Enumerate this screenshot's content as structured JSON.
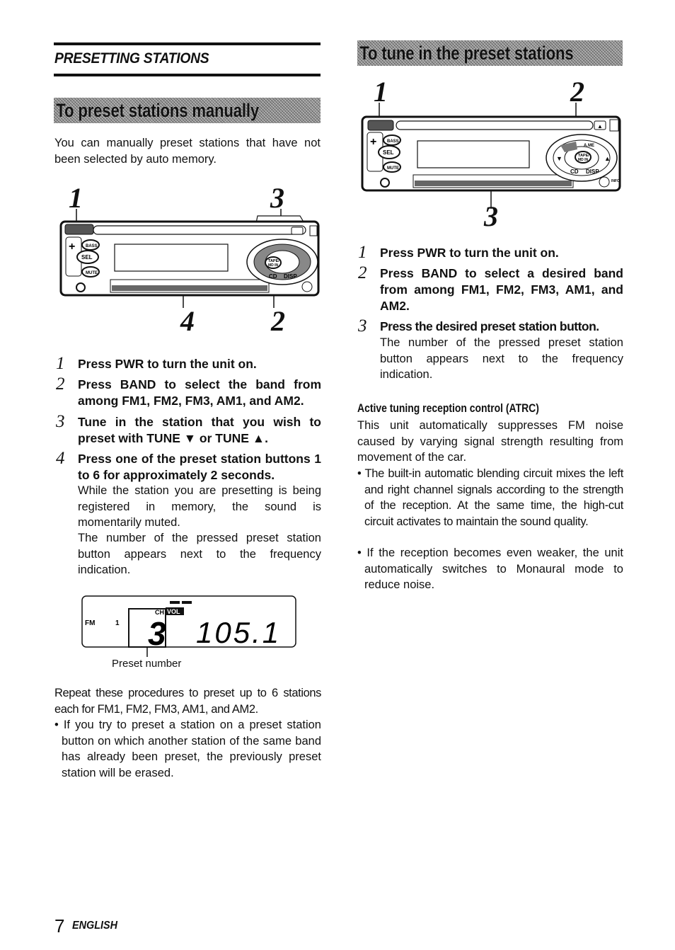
{
  "left_column": {
    "section_title": "PRESETTING STATIONS",
    "banner": "To preset stations manually",
    "intro": "You can manually preset stations that have not been selected by auto memory.",
    "figure_callouts": [
      "1",
      "3",
      "4",
      "2"
    ],
    "steps": [
      {
        "num": "1",
        "text": "Press PWR to turn the unit on."
      },
      {
        "num": "2",
        "text": "Press BAND to select the band from among FM1, FM2, FM3, AM1, and AM2."
      },
      {
        "num": "3",
        "text": "Tune in the station that you wish to preset with TUNE ▼ or TUNE ▲."
      },
      {
        "num": "4",
        "text": "Press one of the preset station buttons 1 to 6 for approximately 2 seconds.",
        "notes": [
          "While the station you are presetting is being registered in memory, the sound is momentarily muted.",
          "The number of the pressed preset station button appears next to the frequency indication."
        ]
      }
    ],
    "display": {
      "band": "FM",
      "band_num": "1",
      "ch_label": "CH",
      "vol_label": "VOL",
      "preset": "3",
      "frequency": "105.1",
      "caption": "Preset number"
    },
    "repeat_text": "Repeat these procedures to preset up to 6 stations each for FM1, FM2, FM3, AM1, and AM2.",
    "bullets": [
      "If you try to preset a station on a preset station button on which another station of the same band has already been preset, the previously preset station will be erased."
    ]
  },
  "right_column": {
    "banner": "To tune in the preset stations",
    "figure_callouts": [
      "1",
      "2",
      "3"
    ],
    "steps": [
      {
        "num": "1",
        "text": "Press PWR to turn the unit on."
      },
      {
        "num": "2",
        "text": "Press BAND to select a desired band from among FM1, FM2, FM3, AM1, and AM2."
      },
      {
        "num": "3",
        "text": "Press the desired preset station button.",
        "notes": [
          "The number of the pressed preset station button appears next to the frequency indication."
        ]
      }
    ],
    "atrc": {
      "heading": "Active tuning reception control (ATRC)",
      "body": "This unit automatically suppresses FM noise caused by varying signal strength resulting from movement of the car.",
      "bullets": [
        "The built-in automatic blending circuit mixes the left and right channel signals according to the strength of the reception. At the same time, the high-cut circuit activates to maintain the sound quality.",
        "If the reception becomes even weaker, the unit automatically switches to Monaural mode to reduce noise."
      ]
    }
  },
  "device_labels": {
    "bass": "BASS",
    "sel": "SEL",
    "mute": "MUTE",
    "tape": "TAPE/",
    "mdin": "MD IN",
    "cd": "CD",
    "disp": "DISP",
    "ams": "A.ME",
    "eject": "▲",
    "info": "INFO"
  },
  "footer": {
    "page_number": "7",
    "language": "ENGLISH"
  }
}
